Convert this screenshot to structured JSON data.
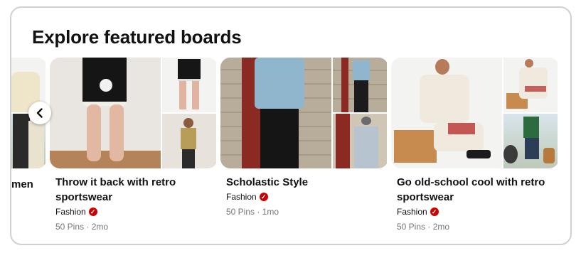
{
  "section_title": "Explore featured boards",
  "nav": {
    "prev_label": "Previous"
  },
  "boards": [
    {
      "title": "men",
      "owner": "",
      "pins": "",
      "updated": ""
    },
    {
      "title": "Throw it back with retro sportswear",
      "owner": "Fashion",
      "pins": "50 Pins · 2mo"
    },
    {
      "title": "Scholastic Style",
      "owner": "Fashion",
      "pins": "50 Pins · 1mo"
    },
    {
      "title": "Go old-school cool with retro sportswear",
      "owner": "Fashion",
      "pins": "50 Pins · 2mo"
    }
  ],
  "colors": {
    "verified_badge": "#cc0000",
    "border": "#d0d0d0",
    "meta_text": "#767676"
  },
  "icons": {
    "nav_prev": "chevron-left-icon",
    "verified": "checkmark-icon"
  }
}
